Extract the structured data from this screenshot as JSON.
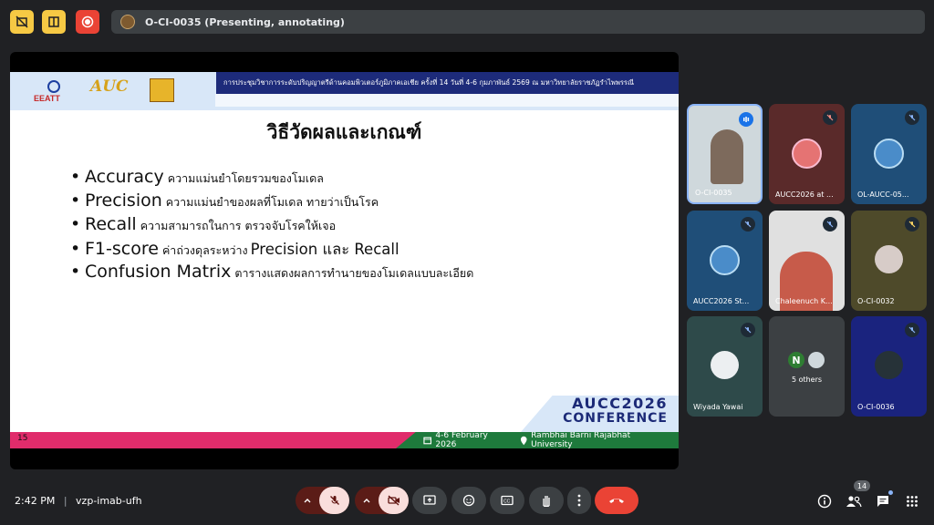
{
  "topbar": {
    "presenting_title": "O-CI-0035 (Presenting, annotating)",
    "icons": [
      "no-captions-icon",
      "layout-icon",
      "record-icon"
    ],
    "colors": {
      "yellow": "#f6c944",
      "red": "#ea4335"
    }
  },
  "slide": {
    "banner_text": "การประชุมวิชาการระดับปริญญาตรีด้านคอมพิวเตอร์ภูมิภาคเอเชีย ครั้งที่ 14   วันที่ 4-6 กุมภาพันธ์ 2569 ณ มหาวิทยาลัยราชภัฏรำไพพรรณี",
    "logo1_text": "EEATT",
    "logo2_text": "AUC",
    "title": "วิธีวัดผลและเกณฑ์",
    "bullets": [
      {
        "term": "Accuracy",
        "desc": "ความแม่นยำโดยรวมของโมเดล",
        "extra": ""
      },
      {
        "term": "Precision",
        "desc": "ความแม่นยำของผลที่โมเดล ทายว่าเป็นโรค",
        "extra": ""
      },
      {
        "term": "Recall",
        "desc": "ความสามารถในการ ตรวจจับโรคให้เจอ",
        "extra": ""
      },
      {
        "term": "F1-score",
        "desc": "ค่าถ่วงดุลระหว่าง",
        "extra": "Precision และ Recall"
      },
      {
        "term": "Confusion Matrix",
        "desc": "ตารางแสดงผลการทำนายของโมเดลแบบละเอียด",
        "extra": ""
      }
    ],
    "conference_line1": "AUCC2026",
    "conference_line2": "CONFERENCE",
    "page_number": "15",
    "footer_date": "4-6 February 2026",
    "footer_venue": "Rambhai Barni Rajabhat University"
  },
  "participants": [
    {
      "name": "O-CI-0035",
      "kind": "video",
      "mic": "speaking"
    },
    {
      "name": "AUCC2026 at ...",
      "kind": "logo",
      "mic": "muted-red"
    },
    {
      "name": "OL-AUCC-05...",
      "kind": "logo",
      "mic": "muted"
    },
    {
      "name": "AUCC2026 St...",
      "kind": "logo",
      "mic": "muted"
    },
    {
      "name": "Chaleenuch K...",
      "kind": "video",
      "mic": "muted"
    },
    {
      "name": "O-CI-0032",
      "kind": "avatar",
      "mic": "muted-yellow"
    },
    {
      "name": "Wiyada Yawai",
      "kind": "avatar",
      "mic": "muted"
    },
    {
      "name": "5 others",
      "kind": "others",
      "initial": "N"
    },
    {
      "name": "O-CI-0036",
      "kind": "avatar",
      "mic": "muted"
    }
  ],
  "bottombar": {
    "time": "2:42 PM",
    "meeting_code": "vzp-imab-ufh",
    "participants_count": "14"
  }
}
